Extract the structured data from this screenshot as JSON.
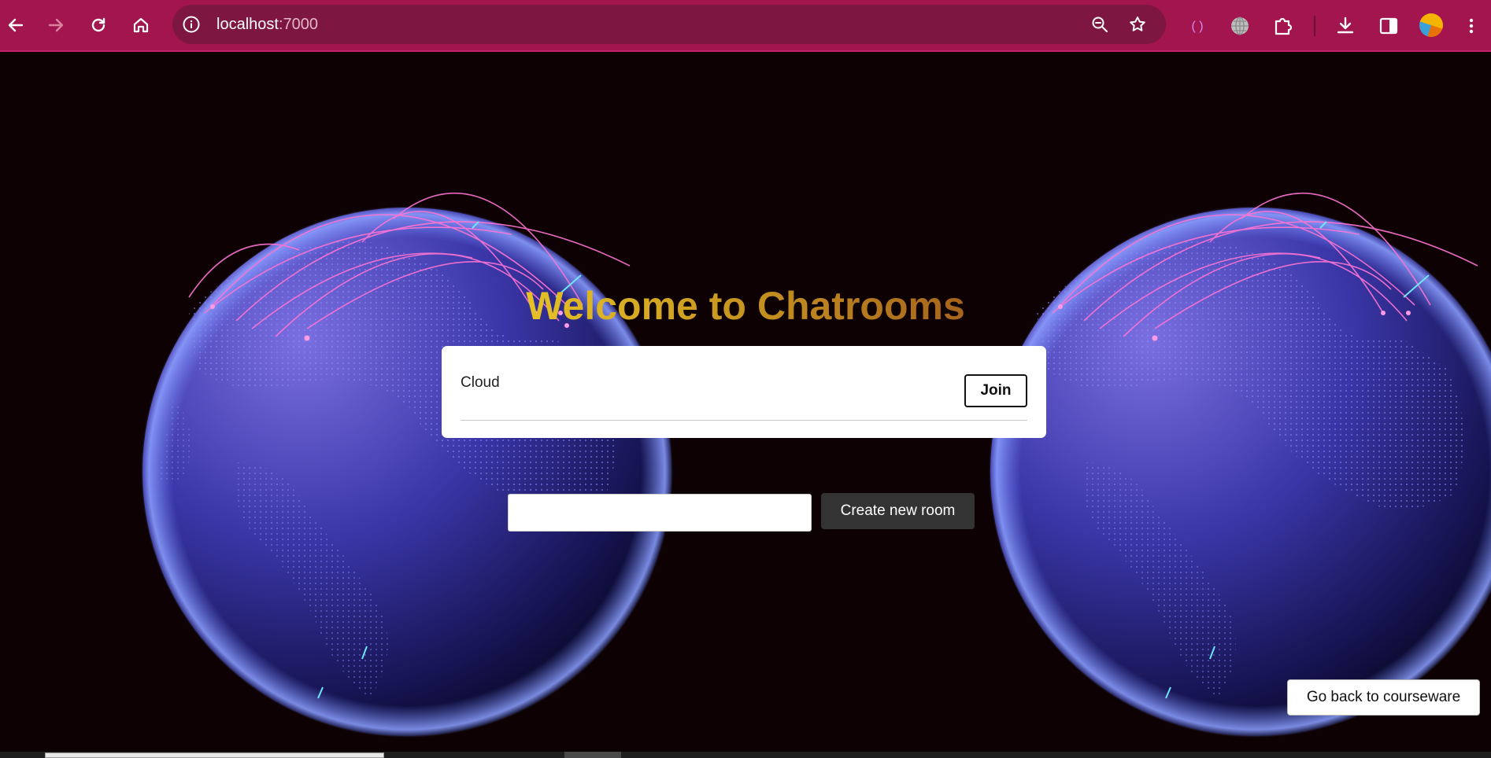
{
  "browser": {
    "url_host": "localhost",
    "url_port": ":7000",
    "icons": [
      "back-arrow-icon",
      "forward-arrow-icon",
      "reload-icon",
      "home-icon",
      "site-info-icon",
      "zoom-out-icon",
      "bookmark-star-icon",
      "extension-parens-icon",
      "globe-extension-icon",
      "puzzle-extensions-icon",
      "download-icon",
      "side-panel-icon",
      "profile-avatar",
      "more-menu-icon"
    ]
  },
  "page": {
    "title": "Welcome to Chatrooms",
    "rooms": [
      {
        "name": "Cloud",
        "join_label": "Join"
      }
    ],
    "new_room": {
      "input_value": "",
      "input_placeholder": "",
      "create_label": "Create new room"
    },
    "back_label": "Go back to courseware"
  },
  "colors": {
    "chrome_bg": "#a3154f",
    "omnibox_bg": "#7d1640",
    "page_bg": "#0d0104",
    "title_gradient": [
      "#f7f52e",
      "#a6631c",
      "#5a0505"
    ],
    "globe": "#4a47d6",
    "arcs": "#ff6fd0"
  }
}
